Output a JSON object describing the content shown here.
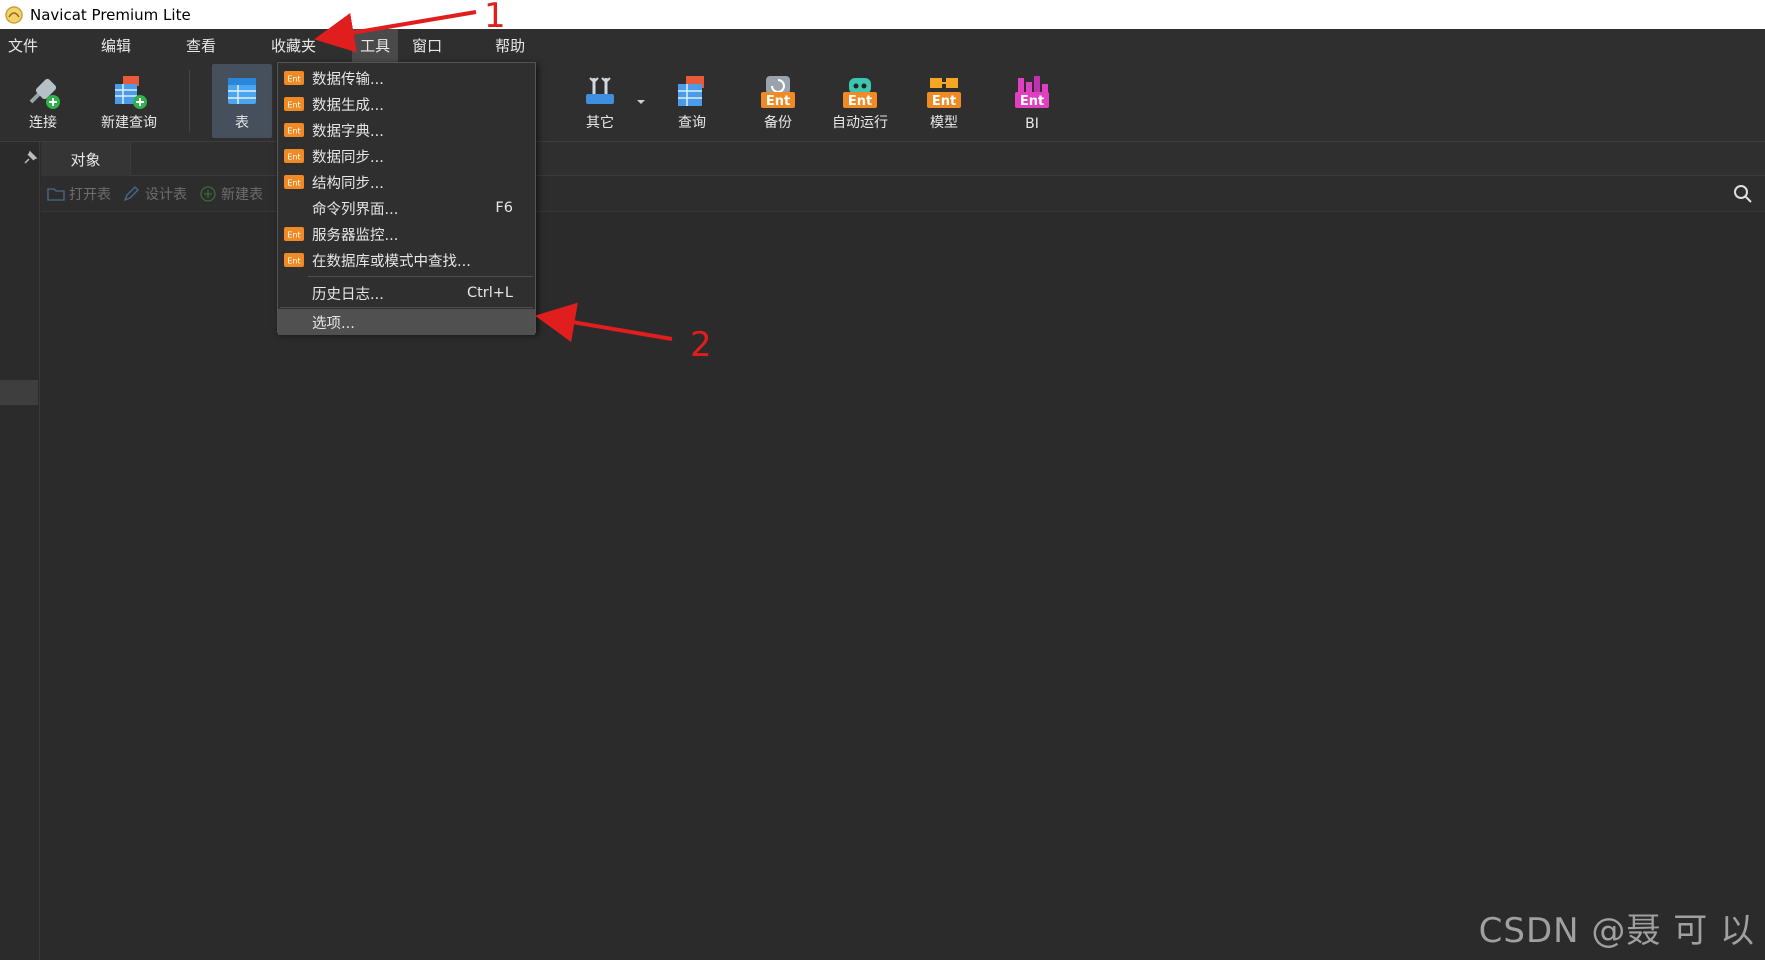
{
  "window": {
    "title": "Navicat Premium Lite"
  },
  "menubar": {
    "items": [
      "文件",
      "编辑",
      "查看",
      "收藏夹",
      "工具",
      "窗口",
      "帮助"
    ],
    "active_index": 4
  },
  "toolbar": {
    "connect": "连接",
    "new_query": "新建查询",
    "table": "表",
    "other": "其它",
    "query": "查询",
    "backup": "备份",
    "automation": "自动运行",
    "model": "模型",
    "bi": "BI",
    "ent_badge": "Ent"
  },
  "tabs": {
    "objects": "对象"
  },
  "object_toolbar": {
    "open_table": "打开表",
    "design_table": "设计表",
    "new_table": "新建表"
  },
  "tools_menu": {
    "items": [
      {
        "label": "数据传输...",
        "ent": true,
        "shortcut": ""
      },
      {
        "label": "数据生成...",
        "ent": true,
        "shortcut": ""
      },
      {
        "label": "数据字典...",
        "ent": true,
        "shortcut": ""
      },
      {
        "label": "数据同步...",
        "ent": true,
        "shortcut": ""
      },
      {
        "label": "结构同步...",
        "ent": true,
        "shortcut": ""
      },
      {
        "label": "命令列界面...",
        "ent": false,
        "shortcut": "F6"
      },
      {
        "label": "服务器监控...",
        "ent": true,
        "shortcut": ""
      },
      {
        "label": "在数据库或模式中查找...",
        "ent": true,
        "shortcut": ""
      },
      {
        "label": "历史日志...",
        "ent": false,
        "shortcut": "Ctrl+L"
      },
      {
        "label": "选项...",
        "ent": false,
        "shortcut": ""
      }
    ],
    "ent_badge": "Ent"
  },
  "annotations": {
    "step1": "1",
    "step2": "2",
    "arrow_color": "#e01e1e"
  },
  "watermark": "CSDN @聂 可 以",
  "colors": {
    "background": "#2b2b2b",
    "ent_orange": "#f08a24",
    "menu_active": "#4a4a4a"
  }
}
